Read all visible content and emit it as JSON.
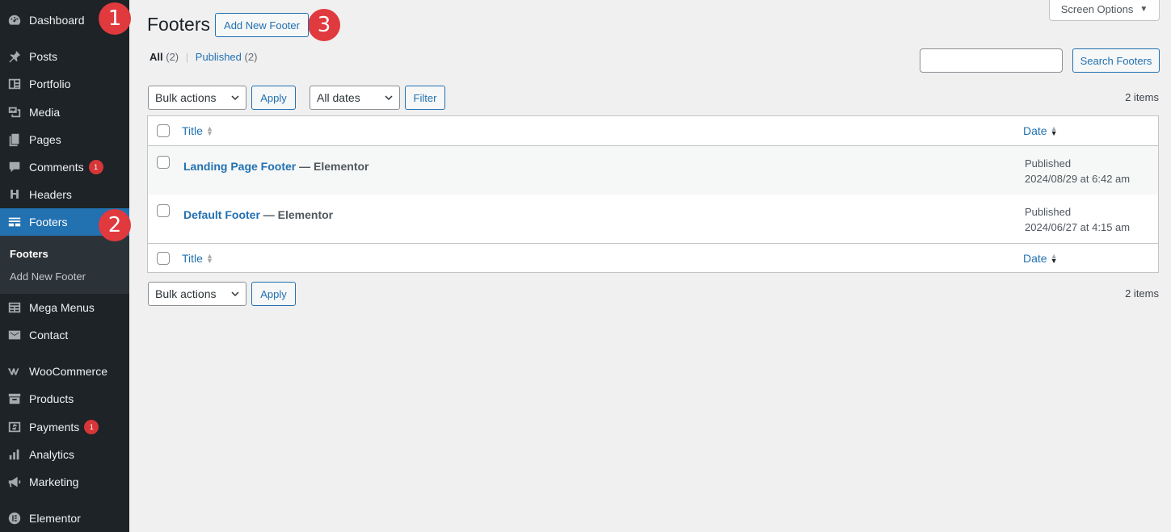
{
  "sidebar": {
    "items": [
      {
        "label": "Dashboard",
        "icon": "dashboard-icon"
      },
      {
        "label": "Posts",
        "icon": "pin-icon"
      },
      {
        "label": "Portfolio",
        "icon": "portfolio-icon"
      },
      {
        "label": "Media",
        "icon": "media-icon"
      },
      {
        "label": "Pages",
        "icon": "pages-icon"
      },
      {
        "label": "Comments",
        "icon": "comments-icon",
        "badge": "1"
      },
      {
        "label": "Headers",
        "icon": "headers-icon"
      },
      {
        "label": "Footers",
        "icon": "footers-icon"
      },
      {
        "label": "Mega Menus",
        "icon": "table-icon"
      },
      {
        "label": "Contact",
        "icon": "mail-icon"
      },
      {
        "label": "WooCommerce",
        "icon": "woocommerce-icon"
      },
      {
        "label": "Products",
        "icon": "archive-icon"
      },
      {
        "label": "Payments",
        "icon": "money-icon",
        "badge": "1"
      },
      {
        "label": "Analytics",
        "icon": "bar-chart-icon"
      },
      {
        "label": "Marketing",
        "icon": "megaphone-icon"
      },
      {
        "label": "Elementor",
        "icon": "elementor-icon"
      }
    ],
    "submenu": [
      "Footers",
      "Add New Footer"
    ]
  },
  "steps": [
    "1",
    "2",
    "3"
  ],
  "header": {
    "title": "Footers",
    "add_new_label": "Add New Footer",
    "screen_options_label": "Screen Options"
  },
  "filters": {
    "all_label": "All",
    "all_count": "(2)",
    "published_label": "Published",
    "published_count": "(2)",
    "separator": "|"
  },
  "search": {
    "button_label": "Search Footers",
    "value": ""
  },
  "tablenav": {
    "bulk_actions": "Bulk actions",
    "apply": "Apply",
    "all_dates": "All dates",
    "filter": "Filter",
    "items_count": "2 items"
  },
  "table": {
    "columns": {
      "title": "Title",
      "date": "Date"
    },
    "rows": [
      {
        "title": "Landing Page Footer",
        "state": "— Elementor",
        "status": "Published",
        "date": "2024/08/29 at 6:42 am"
      },
      {
        "title": "Default Footer",
        "state": "— Elementor",
        "status": "Published",
        "date": "2024/06/27 at 4:15 am"
      }
    ]
  },
  "colors": {
    "sidebar_bg": "#1d2327",
    "accent": "#2271b1",
    "step_marker": "#e0393e",
    "badge": "#d63638",
    "page_bg": "#f0f0f1"
  }
}
